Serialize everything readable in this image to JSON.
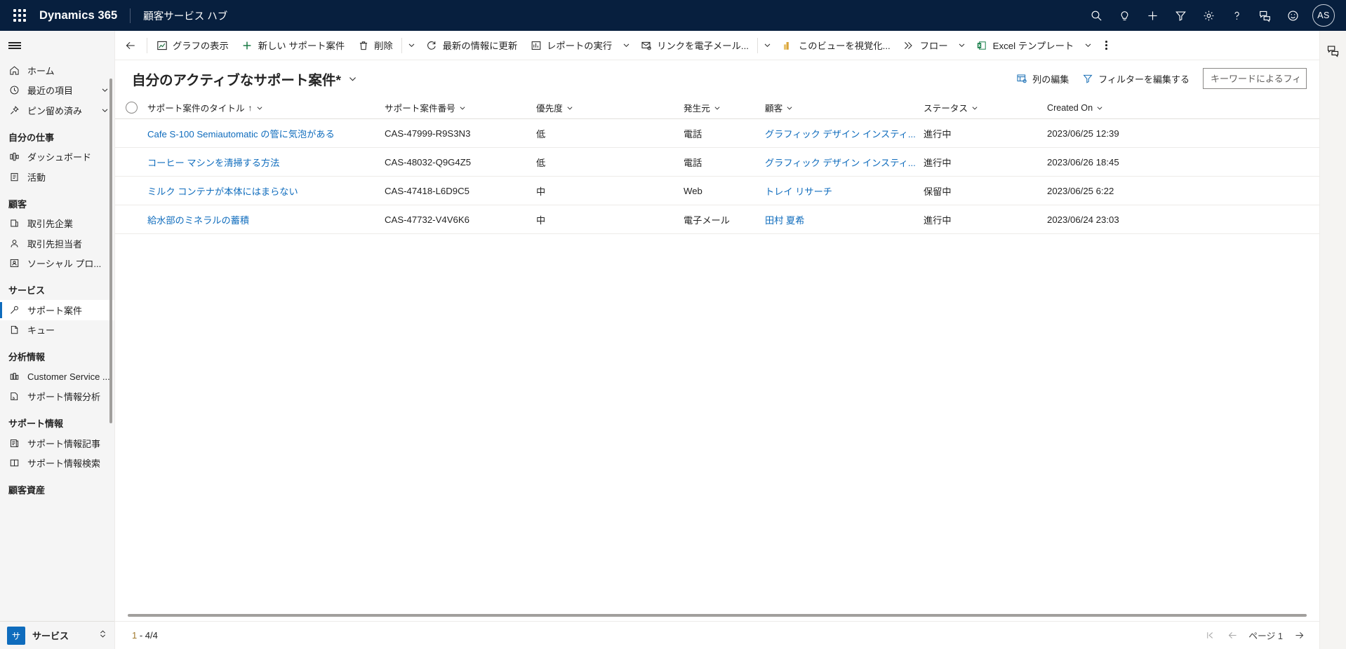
{
  "header": {
    "waffle_label": "app-launcher",
    "brand": "Dynamics 365",
    "app_name": "顧客サービス ハブ",
    "icons": [
      {
        "name": "search-icon",
        "title": "検索"
      },
      {
        "name": "lightbulb-icon",
        "title": "アイデア"
      },
      {
        "name": "plus-icon",
        "title": "新規作成"
      },
      {
        "name": "filter-icon",
        "title": "フィルター"
      },
      {
        "name": "gear-icon",
        "title": "設定"
      },
      {
        "name": "help-icon",
        "title": "ヘルプ"
      },
      {
        "name": "chat-icon",
        "title": "チャット"
      },
      {
        "name": "smiley-icon",
        "title": "フィードバック"
      }
    ],
    "avatar_initials": "AS"
  },
  "sitemap": {
    "hamburger_label": "サイト マップ",
    "items": [
      {
        "label": "ホーム",
        "icon": "home-icon",
        "chevron": false,
        "selected": false,
        "name": "home"
      },
      {
        "label": "最近の項目",
        "icon": "clock-icon",
        "chevron": true,
        "selected": false,
        "name": "recent"
      },
      {
        "label": "ピン留め済み",
        "icon": "pin-icon",
        "chevron": true,
        "selected": false,
        "name": "pinned"
      }
    ],
    "groups": [
      {
        "title": "自分の仕事",
        "name": "my-work",
        "items": [
          {
            "label": "ダッシュボード",
            "icon": "dashboard-icon",
            "selected": false,
            "name": "dashboards"
          },
          {
            "label": "活動",
            "icon": "activity-icon",
            "selected": false,
            "name": "activities"
          }
        ]
      },
      {
        "title": "顧客",
        "name": "customers",
        "items": [
          {
            "label": "取引先企業",
            "icon": "account-icon",
            "selected": false,
            "name": "accounts"
          },
          {
            "label": "取引先担当者",
            "icon": "contact-icon",
            "selected": false,
            "name": "contacts"
          },
          {
            "label": "ソーシャル プロ...",
            "icon": "social-profile-icon",
            "selected": false,
            "name": "social-profiles"
          }
        ]
      },
      {
        "title": "サービス",
        "name": "service",
        "items": [
          {
            "label": "サポート案件",
            "icon": "case-icon",
            "selected": true,
            "name": "cases"
          },
          {
            "label": "キュー",
            "icon": "queue-icon",
            "selected": false,
            "name": "queues"
          }
        ]
      },
      {
        "title": "分析情報",
        "name": "insights",
        "items": [
          {
            "label": "Customer Service ...",
            "icon": "chart-icon",
            "selected": false,
            "name": "customer-service-insights"
          },
          {
            "label": "サポート情報分析",
            "icon": "knowledge-analytics-icon",
            "selected": false,
            "name": "knowledge-analytics"
          }
        ]
      },
      {
        "title": "サポート情報",
        "name": "knowledge",
        "items": [
          {
            "label": "サポート情報記事",
            "icon": "article-icon",
            "selected": false,
            "name": "knowledge-articles"
          },
          {
            "label": "サポート情報検索",
            "icon": "book-icon",
            "selected": false,
            "name": "knowledge-search"
          }
        ]
      },
      {
        "title": "顧客資産",
        "name": "customer-assets",
        "items": []
      }
    ],
    "area_switcher": {
      "badge": "サ",
      "label": "サービス"
    }
  },
  "commandbar": {
    "back_label": "戻る",
    "buttons": [
      {
        "label": "グラフの表示",
        "icon": "chart-view-icon",
        "caret": false,
        "name": "show-chart"
      },
      {
        "label": "新しい サポート案件",
        "icon": "plus-icon",
        "caret": false,
        "name": "new-case"
      },
      {
        "label": "削除",
        "icon": "trash-icon",
        "caret": true,
        "divider_before_caret": true,
        "name": "delete"
      },
      {
        "label": "最新の情報に更新",
        "icon": "refresh-icon",
        "caret": false,
        "name": "refresh"
      },
      {
        "label": "レポートの実行",
        "icon": "report-icon",
        "caret": true,
        "name": "run-report"
      },
      {
        "label": "リンクを電子メール...",
        "icon": "email-link-icon",
        "caret": true,
        "divider_before_caret": true,
        "name": "email-a-link"
      },
      {
        "label": "このビューを視覚化...",
        "icon": "powerbi-icon",
        "caret": false,
        "name": "visualize-this-view"
      },
      {
        "label": "フロー",
        "icon": "flow-icon",
        "caret": true,
        "name": "flow"
      },
      {
        "label": "Excel テンプレート",
        "icon": "excel-icon",
        "caret": true,
        "name": "excel-templates"
      }
    ],
    "overflow_label": "その他のコマンド"
  },
  "view": {
    "title": "自分のアクティブなサポート案件*",
    "title_caret_label": "ビューの選択",
    "edit_columns": "列の編集",
    "edit_filters": "フィルターを編集する",
    "search_placeholder": "キーワードによるフィルタ",
    "search_value": ""
  },
  "grid": {
    "select_all_label": "すべて選択",
    "columns": [
      {
        "key": "title",
        "label": "サポート案件のタイトル",
        "sorted": true,
        "sort_dir": "↑",
        "class": "c-title"
      },
      {
        "key": "number",
        "label": "サポート案件番号",
        "sorted": false,
        "sort_dir": "",
        "class": "c-number"
      },
      {
        "key": "prio",
        "label": "優先度",
        "sorted": false,
        "sort_dir": "",
        "class": "c-prio"
      },
      {
        "key": "origin",
        "label": "発生元",
        "sorted": false,
        "sort_dir": "",
        "class": "c-origin"
      },
      {
        "key": "cust",
        "label": "顧客",
        "sorted": false,
        "sort_dir": "",
        "class": "c-cust"
      },
      {
        "key": "status",
        "label": "ステータス",
        "sorted": false,
        "sort_dir": "",
        "class": "c-status"
      },
      {
        "key": "created",
        "label": "Created On",
        "sorted": false,
        "sort_dir": "",
        "class": "c-created"
      }
    ],
    "rows": [
      {
        "title": "Cafe S-100 Semiautomatic の管に気泡がある",
        "number": "CAS-47999-R9S3N3",
        "prio": "低",
        "origin": "電話",
        "cust": "グラフィック デザイン インスティ...",
        "status": "進行中",
        "created": "2023/06/25 12:39"
      },
      {
        "title": "コーヒー マシンを清掃する方法",
        "number": "CAS-48032-Q9G4Z5",
        "prio": "低",
        "origin": "電話",
        "cust": "グラフィック デザイン インスティ...",
        "status": "進行中",
        "created": "2023/06/26 18:45"
      },
      {
        "title": "ミルク コンテナが本体にはまらない",
        "number": "CAS-47418-L6D9C5",
        "prio": "中",
        "origin": "Web",
        "cust": "トレイ リサーチ",
        "status": "保留中",
        "created": "2023/06/25 6:22"
      },
      {
        "title": "給水部のミネラルの蓄積",
        "number": "CAS-47732-V4V6K6",
        "prio": "中",
        "origin": "電子メール",
        "cust": "田村 夏希",
        "status": "進行中",
        "created": "2023/06/24 23:03"
      }
    ]
  },
  "footer": {
    "row_count_prefix": "1",
    "row_count_rest": " - 4/4",
    "page_label": "ページ 1",
    "first_page_label": "最初のページ",
    "prev_page_label": "前のページ",
    "next_page_label": "次のページ"
  },
  "rightrail": {
    "icons": [
      {
        "name": "chat-panel-icon",
        "title": "会話"
      }
    ]
  },
  "colors": {
    "header_bg": "#071F3E",
    "accent": "#0f6cbd",
    "link": "#0f6cbd",
    "selected_bar": "#0f6cbd",
    "area_badge": "#0f6cbd"
  }
}
